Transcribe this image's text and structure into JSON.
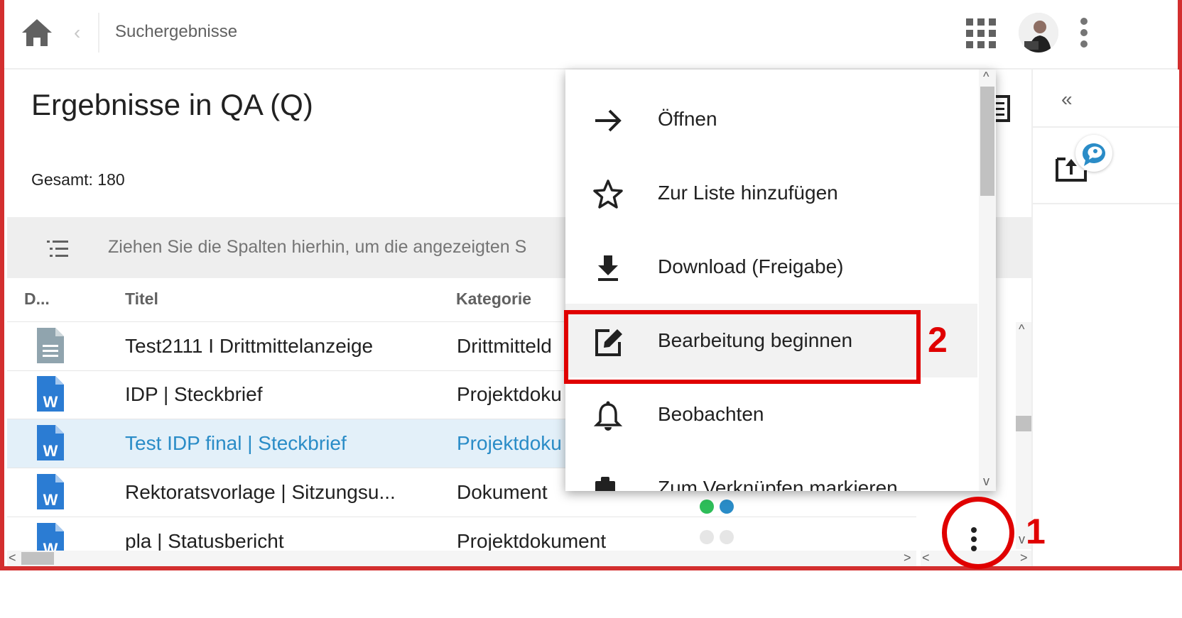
{
  "topbar": {
    "home_icon": "home-icon",
    "back_icon": "chevron-left-icon",
    "back_glyph": "‹",
    "breadcrumb": "Suchergebnisse",
    "apps_icon": "grid-icon",
    "more_icon": "more-vertical-icon"
  },
  "main": {
    "heading": "Ergebnisse in QA (Q)",
    "total": "Gesamt: 180",
    "group_hint": "Ziehen Sie die Spalten hierhin, um die angezeigten S",
    "columns": [
      "D...",
      "Titel",
      "Kategorie"
    ],
    "rows": [
      {
        "icon": "generic-doc-icon",
        "title": "Test2111 I Drittmittelanzeige",
        "category": "Drittmitteld",
        "selected": false
      },
      {
        "icon": "word-doc-icon",
        "title": "IDP | Steckbrief",
        "category": "Projektdoku",
        "selected": false
      },
      {
        "icon": "word-doc-icon",
        "title": "Test IDP final | Steckbrief",
        "category": "Projektdoku",
        "selected": true
      },
      {
        "icon": "word-doc-icon",
        "title": "Rektoratsvorlage | Sitzungsu...",
        "category": "Dokument",
        "selected": false
      },
      {
        "icon": "word-doc-icon",
        "title": "pla | Statusbericht",
        "category": "Projektdokument",
        "selected": false
      }
    ]
  },
  "context_menu": {
    "items": [
      {
        "label": "Öffnen",
        "icon": "arrow-right-icon"
      },
      {
        "label": "Zur Liste hinzufügen",
        "icon": "star-icon"
      },
      {
        "label": "Download (Freigabe)",
        "icon": "download-icon"
      },
      {
        "label": "Bearbeitung beginnen",
        "icon": "edit-icon"
      },
      {
        "label": "Beobachten",
        "icon": "bell-icon"
      },
      {
        "label": "Zum Verknüpfen markieren",
        "icon": "clipboard-link-icon"
      }
    ]
  },
  "right_panel": {
    "collapse_glyph": "«",
    "upload_icon": "upload-icon",
    "chat_icon": "chat-bubble-icon"
  },
  "annotations": {
    "step1": "1",
    "step2": "2",
    "color": "#e00000"
  },
  "colors": {
    "accent": "#2a8cc7",
    "word_blue": "#2b7cd3",
    "status_green": "#2ebd59",
    "status_blue": "#2a8cc7"
  }
}
